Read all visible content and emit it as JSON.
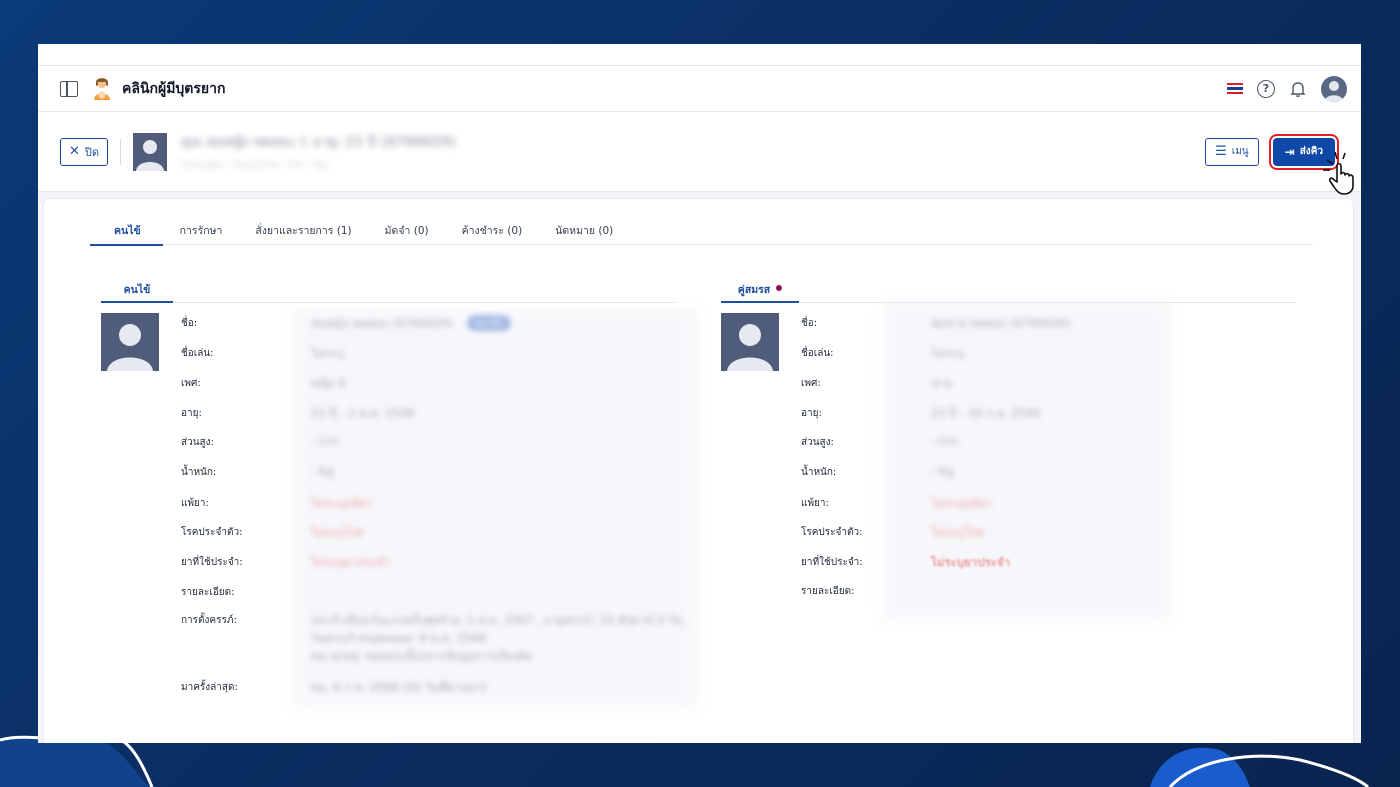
{
  "app": {
    "title": "คลินิกผู้มีบุตรยาก"
  },
  "patient_bar": {
    "close_label": "ปิด",
    "patient_name": "คุณ สมหญิง ทดสอบ ♀ อายุ: 21 ปี (6700029)",
    "patient_sub": "ไม่ระบุพ่อ · ไม่ระบุโรค · Cm · Kg",
    "menu_label": "เมนู",
    "send_label": "ส่งคิว"
  },
  "tabs": [
    {
      "label": "คนไข้"
    },
    {
      "label": "การรักษา"
    },
    {
      "label": "สั่งยาและรายการ (1)"
    },
    {
      "label": "มัดจำ (0)"
    },
    {
      "label": "ค้างชำระ (0)"
    },
    {
      "label": "นัดหมาย (0)"
    }
  ],
  "patient_section": {
    "tab_label": "คนไข้",
    "labels": {
      "name": "ชื่อ:",
      "nickname": "ชื่อเล่น:",
      "sex": "เพศ:",
      "age": "อายุ:",
      "height": "ส่วนสูง:",
      "weight": "น้ำหนัก:",
      "allergy": "แพ้ยา:",
      "disease": "โรคประจำตัว:",
      "medication": "ยาที่ใช้ประจำ:",
      "detail": "รายละเอียด:",
      "pregnancy": "การตั้งครรภ์:",
      "last_visit": "มาครั้งล่าสุด:"
    },
    "values": {
      "name": "สมหญิง ทดสอบ (6700029)",
      "badge": "สมาชิก",
      "nickname": "ไม่ระบุ",
      "sex": "หญิง ♀",
      "age": "21 ปี - 2 พ.ค. 2546",
      "height": "- Cm",
      "weight": "- Kg",
      "allergy": "ไม่ระบุแพ้ยา",
      "disease": "ไม่ระบุโรค",
      "medication": "ไม่ระบุยาประจำ",
      "pregnancy_1": "ประจำเดือนวันแรกครั้งสุดท้าย: 1 ส.ค. 2567 , อายุครรภ์: 33 สัปดาห์ 0 วัน ,",
      "pregnancy_2": "วันครบกำหนดคลอด: 8 พ.ค. 2568",
      "pregnancy_3": "หมายเหตุ: ทดสอบเบื้องจากข้อมูลการเรียงตัด",
      "last_visit": "พฤ. 6 ก.พ. 2568 (42 วันที่ผ่านมา)"
    }
  },
  "spouse_section": {
    "tab_label": "คู่สมรส",
    "labels": {
      "name": "ชื่อ:",
      "nickname": "ชื่อเล่น:",
      "sex": "เพศ:",
      "age": "อายุ:",
      "height": "ส่วนสูง:",
      "weight": "น้ำหนัก:",
      "allergy": "แพ้ยา:",
      "disease": "โรคประจำตัว:",
      "medication": "ยาที่ใช้ประจำ:",
      "detail": "รายละเอียด:"
    },
    "values": {
      "name": "สมชาย ทดสอบ (6700030)",
      "nickname": "ไม่ระบุ",
      "sex": "ชาย",
      "age": "23 ปี - 16 ก.ย. 2544",
      "height": "- Cm",
      "weight": "- Kg",
      "allergy": "ไม่ระบุแพ้ยา",
      "disease": "ไม่ระบุโรค",
      "medication": "ไม่ระบุยาประจำ"
    }
  },
  "colors": {
    "primary": "#1f4fa0",
    "send_button": "#0f48a8",
    "highlight": "#e3202a",
    "spouse_dot": "#8b1258"
  }
}
